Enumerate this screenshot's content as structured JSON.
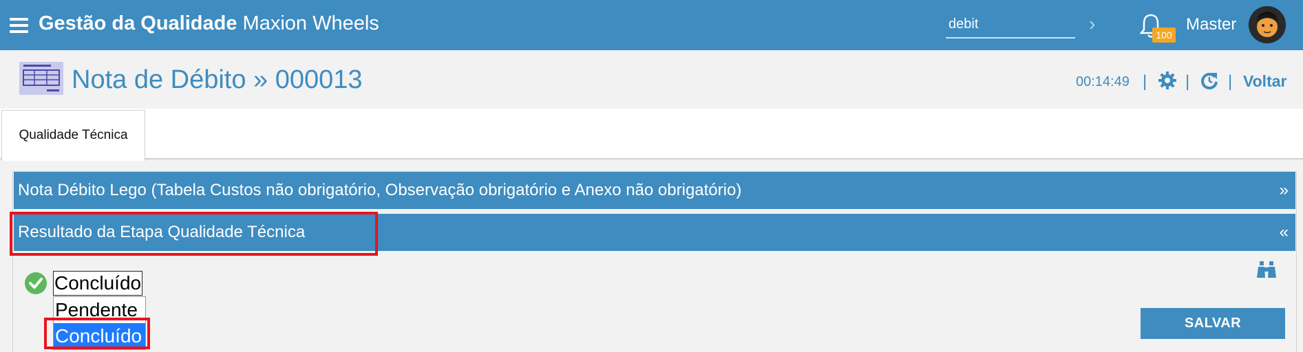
{
  "app": {
    "title_bold": "Gestão da Qualidade",
    "title_rest": "Maxion Wheels",
    "search_value": "debit",
    "notification_count": "100",
    "user_name": "Master"
  },
  "page": {
    "title": "Nota de Débito » 000013",
    "timer": "00:14:49",
    "separator": "|",
    "back_label": "Voltar"
  },
  "tabs": [
    {
      "label": "Qualidade Técnica"
    }
  ],
  "panels": [
    {
      "label": "Nota Débito Lego (Tabela Custos não obrigatório, Observação obrigatório e Anexo não obrigatório)",
      "chevron": "»"
    },
    {
      "label": "Resultado da Etapa Qualidade Técnica",
      "chevron": "«"
    }
  ],
  "status_select": {
    "current": "Concluído",
    "options": [
      "Pendente",
      "Concluído"
    ]
  },
  "save_label": "SALVAR",
  "colors": {
    "primary": "#3e8cc0",
    "highlight": "#e8141c",
    "badge": "#f5a623",
    "selected_option": "#1e7bff",
    "success": "#5cb85c"
  }
}
